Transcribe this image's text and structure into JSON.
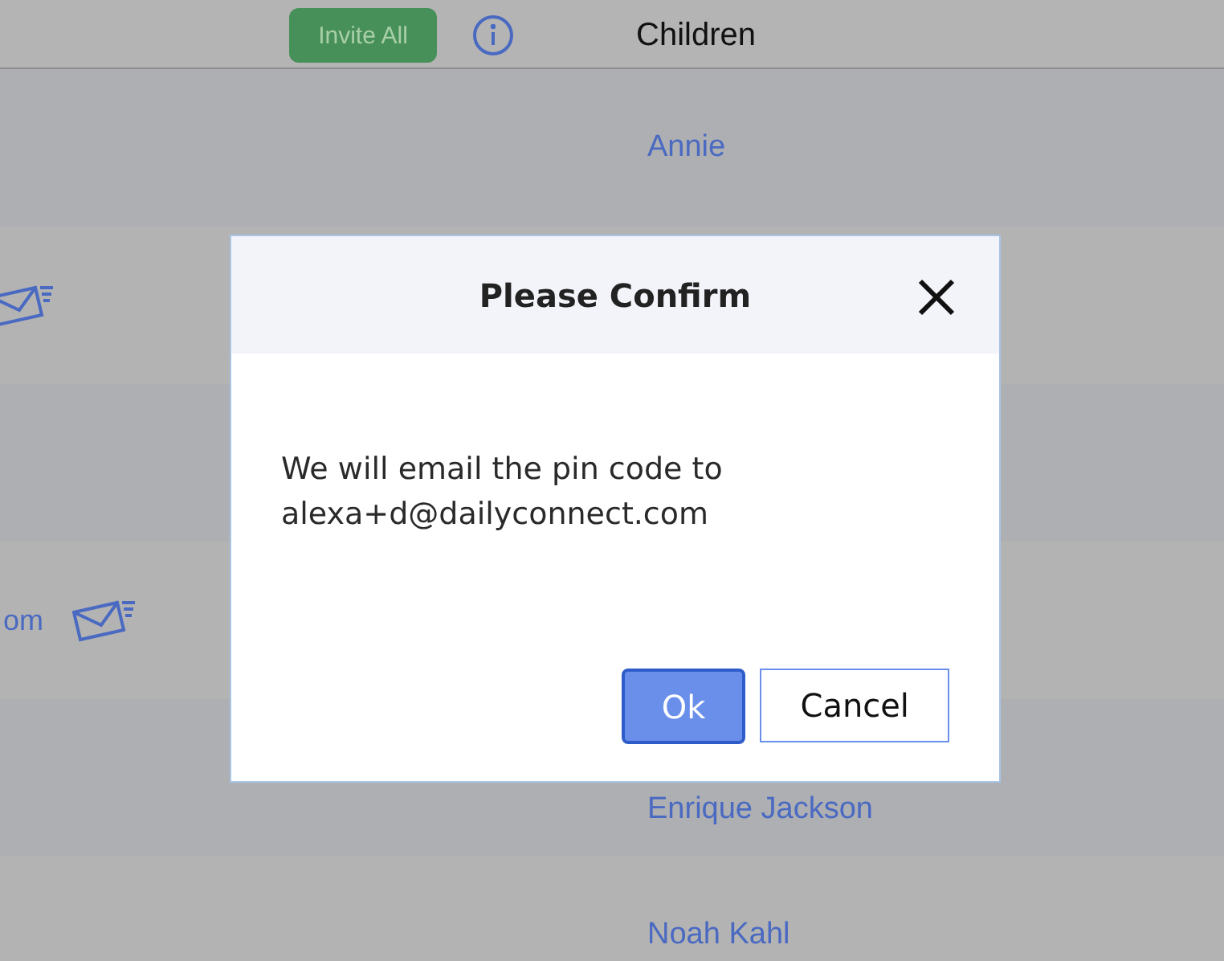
{
  "header": {
    "invite_button": "Invite All",
    "column_title": "Children"
  },
  "rows": [
    {
      "name": "Annie",
      "email_icon": false
    },
    {
      "email_icon": true
    },
    {
      "email_icon": false
    },
    {
      "email": "om",
      "email_icon": true
    },
    {
      "name": "Enrique Jackson",
      "email_icon": false
    },
    {
      "name": "Noah Kahl",
      "email_icon": false
    }
  ],
  "dialog": {
    "title": "Please Confirm",
    "message": "We will email the pin code to alexa+d@dailyconnect.com",
    "buttons": [
      {
        "label": "Ok",
        "kind": "primary"
      },
      {
        "label": "Cancel",
        "kind": "secondary"
      }
    ]
  }
}
